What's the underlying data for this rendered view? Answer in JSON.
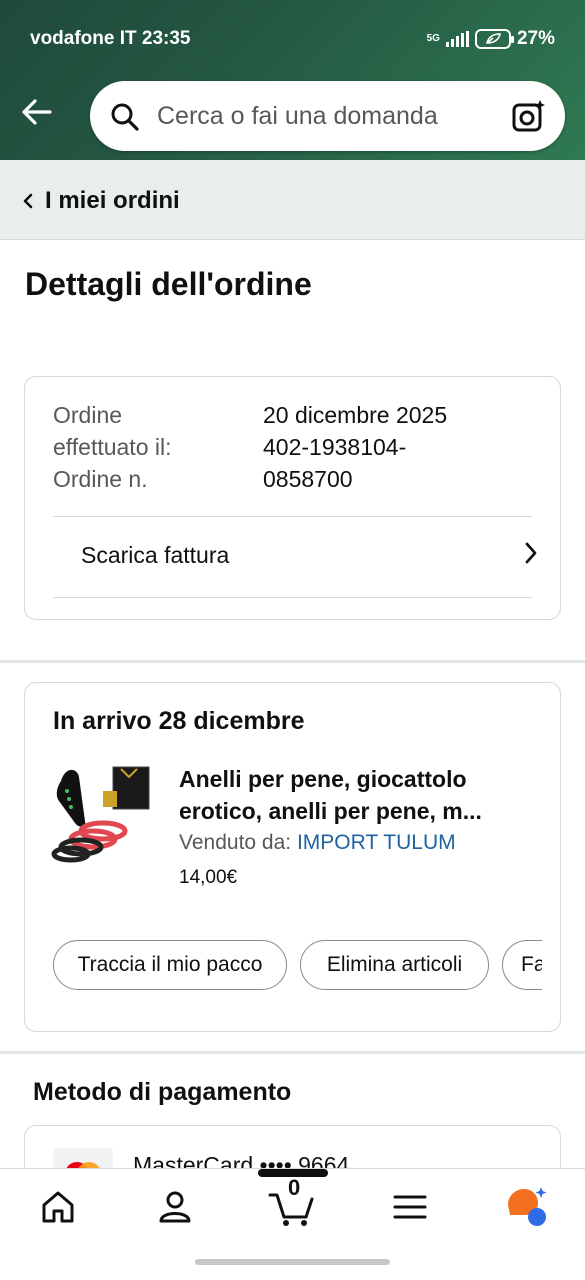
{
  "status_bar": {
    "carrier": "vodafone IT",
    "time": "23:35",
    "network": "5G",
    "battery": "27%"
  },
  "search": {
    "placeholder": "Cerca o fai una domanda"
  },
  "breadcrumb": {
    "label": "I miei ordini"
  },
  "page": {
    "title": "Dettagli dell'ordine"
  },
  "order_info": {
    "placed_label": "Ordine effettuato il:",
    "placed_label_line1": "Ordine",
    "placed_label_line2": "effettuato il:",
    "placed_value": "20 dicembre 2025",
    "number_label": "Ordine n.",
    "number_value_line1": "402-1938104-",
    "number_value_line2": "0858700",
    "invoice_link": "Scarica fattura"
  },
  "shipment": {
    "arrival": "In arrivo 28 dicembre",
    "product_title": "Anelli per pene, giocattolo erotico, anelli per pene, m...",
    "product_title_line1": "Anelli per pene, giocattolo",
    "product_title_line2": "erotico, anelli per pene, m...",
    "sold_by_label": "Venduto da: ",
    "seller": "IMPORT TULUM",
    "price": "14,00€",
    "actions": [
      "Traccia il mio pacco",
      "Elimina articoli",
      "Fa"
    ]
  },
  "payment": {
    "title": "Metodo di pagamento",
    "card_text": "MasterCard •••• 9664"
  },
  "bottom_nav": {
    "cart_count": "0",
    "items": [
      "home-icon",
      "account-icon",
      "cart-icon",
      "menu-icon",
      "rufus-assistant-icon"
    ]
  },
  "colors": {
    "header_green": "#245843",
    "link_blue": "#2162a1",
    "product_ring_red": "#e0474f"
  }
}
